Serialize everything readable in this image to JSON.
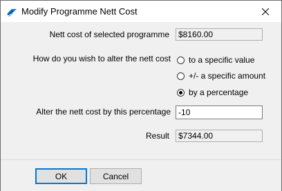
{
  "window": {
    "title": "Modify Programme Nett Cost",
    "icon": "app-icon",
    "close_icon": "close-icon"
  },
  "form": {
    "nett_cost_label": "Nett cost of selected programme",
    "nett_cost_value": "$8160.00",
    "alter_label": "How do you wish to alter the nett cost",
    "options": [
      {
        "label": "to a specific value",
        "checked": false
      },
      {
        "label": "+/- a specific amount",
        "checked": false
      },
      {
        "label": "by a percentage",
        "checked": true
      }
    ],
    "percentage_label": "Alter the nett cost by this percentage",
    "percentage_value": "-10",
    "result_label": "Result",
    "result_value": "$7344.00"
  },
  "buttons": {
    "ok": "OK",
    "cancel": "Cancel"
  },
  "colors": {
    "accent": "#0078d7",
    "dialog_bg": "#f0f0f0"
  }
}
